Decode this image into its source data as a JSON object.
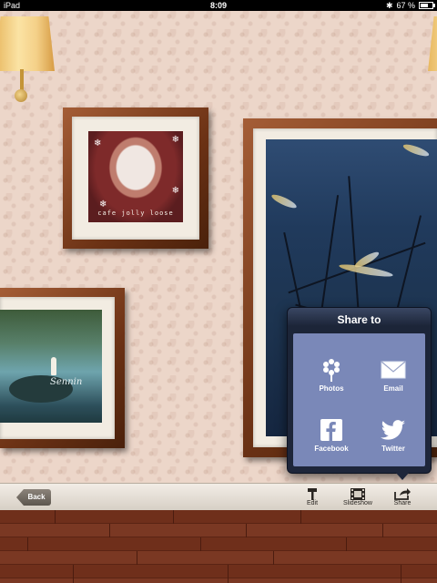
{
  "status_bar": {
    "device": "iPad",
    "time": "8:09",
    "battery": "67 %",
    "battery_level": 0.67
  },
  "frames": {
    "coffee": {
      "caption": "cafe jolly loose"
    },
    "lake": {
      "signature": "Sennin"
    }
  },
  "share_popover": {
    "title": "Share to",
    "items": [
      {
        "label": "Photos",
        "icon": "flower-icon"
      },
      {
        "label": "Email",
        "icon": "envelope-icon"
      },
      {
        "label": "Facebook",
        "icon": "facebook-icon"
      },
      {
        "label": "Twitter",
        "icon": "twitter-bird-icon"
      }
    ]
  },
  "toolbar": {
    "back": "Back",
    "edit": "Edit",
    "slideshow": "Slideshow",
    "share": "Share"
  }
}
